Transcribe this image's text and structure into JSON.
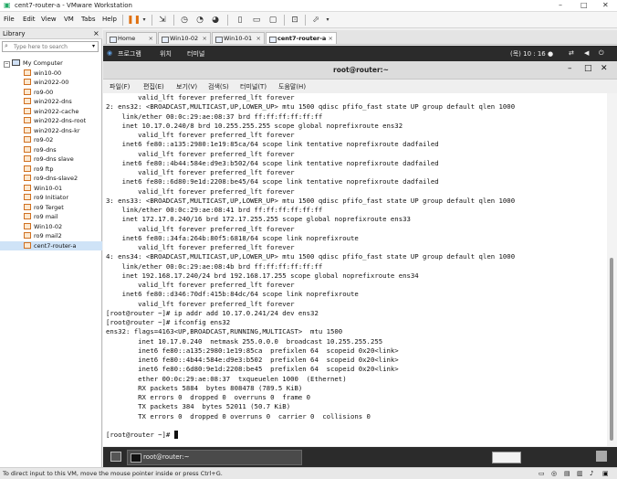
{
  "window": {
    "title": "cent7-router-a - VMware Workstation",
    "min_label": "–",
    "max_label": "□",
    "close_label": "✕"
  },
  "menu": {
    "file": "File",
    "edit": "Edit",
    "view": "View",
    "vm": "VM",
    "tabs": "Tabs",
    "help": "Help"
  },
  "library": {
    "title": "Library",
    "close": "×",
    "search_placeholder": "Type here to search",
    "root": "My Computer",
    "items": [
      "win10-00",
      "win2022-00",
      "ro9-00",
      "win2022-dns",
      "win2022-cache",
      "win2022-dns-root",
      "win2022-dns-kr",
      "ro9-02",
      "ro9-dns",
      "ro9-dns slave",
      "ro9 ftp",
      "ro9-dns-slave2",
      "Win10-01",
      "ro9 Initiator",
      "ro9 Terget",
      "ro9 mail",
      "Win10-02",
      "ro9 mail2",
      "cent7-router-a"
    ]
  },
  "tabs": [
    {
      "label": "Home"
    },
    {
      "label": "Win10-02"
    },
    {
      "label": "Win10-01"
    },
    {
      "label": "cent7-router-a"
    }
  ],
  "gnome": {
    "apps": "프로그램",
    "places": "위치",
    "terminal": "터미널",
    "clock": "(목) 10 : 16 ●"
  },
  "terminal": {
    "title": "root@router:~",
    "menu": [
      "파일(F)",
      "편집(E)",
      "보기(V)",
      "검색(S)",
      "터미널(T)",
      "도움말(H)"
    ],
    "lines": [
      "        valid_lft forever preferred_lft forever",
      "2: ens32: <BROADCAST,MULTICAST,UP,LOWER_UP> mtu 1500 qdisc pfifo_fast state UP group default qlen 1000",
      "    link/ether 00:0c:29:ae:08:37 brd ff:ff:ff:ff:ff:ff",
      "    inet 10.17.0.240/8 brd 10.255.255.255 scope global noprefixroute ens32",
      "        valid_lft forever preferred_lft forever",
      "    inet6 fe80::a135:2980:1e19:85ca/64 scope link tentative noprefixroute dadfailed",
      "        valid_lft forever preferred_lft forever",
      "    inet6 fe80::4b44:584e:d9e3:b502/64 scope link tentative noprefixroute dadfailed",
      "        valid_lft forever preferred_lft forever",
      "    inet6 fe80::6d80:9e1d:2208:be45/64 scope link tentative noprefixroute dadfailed",
      "        valid_lft forever preferred_lft forever",
      "3: ens33: <BROADCAST,MULTICAST,UP,LOWER_UP> mtu 1500 qdisc pfifo_fast state UP group default qlen 1000",
      "    link/ether 00:0c:29:ae:08:41 brd ff:ff:ff:ff:ff:ff",
      "    inet 172.17.0.240/16 brd 172.17.255.255 scope global noprefixroute ens33",
      "        valid_lft forever preferred_lft forever",
      "    inet6 fe80::34fa:264b:80f5:6818/64 scope link noprefixroute",
      "        valid_lft forever preferred_lft forever",
      "4: ens34: <BROADCAST,MULTICAST,UP,LOWER_UP> mtu 1500 qdisc pfifo_fast state UP group default qlen 1000",
      "    link/ether 00:0c:29:ae:08:4b brd ff:ff:ff:ff:ff:ff",
      "    inet 192.168.17.240/24 brd 192.168.17.255 scope global noprefixroute ens34",
      "        valid_lft forever preferred_lft forever",
      "    inet6 fe80::d346:70df:415b:84dc/64 scope link noprefixroute",
      "        valid_lft forever preferred_lft forever",
      "[root@router ~]# ip addr add 10.17.0.241/24 dev ens32",
      "[root@router ~]# ifconfig ens32",
      "ens32: flags=4163<UP,BROADCAST,RUNNING,MULTICAST>  mtu 1500",
      "        inet 10.17.0.240  netmask 255.0.0.0  broadcast 10.255.255.255",
      "        inet6 fe80::a135:2980:1e19:85ca  prefixlen 64  scopeid 0x20<link>",
      "        inet6 fe80::4b44:584e:d9e3:b502  prefixlen 64  scopeid 0x20<link>",
      "        inet6 fe80::6d80:9e1d:2208:be45  prefixlen 64  scopeid 0x20<link>",
      "        ether 00:0c:29:ae:08:37  txqueuelen 1000  (Ethernet)",
      "        RX packets 5884  bytes 808478 (789.5 KiB)",
      "        RX errors 0  dropped 0  overruns 0  frame 0",
      "        TX packets 384  bytes 52011 (50.7 KiB)",
      "        TX errors 0  dropped 0 overruns 0  carrier 0  collisions 0",
      "",
      "[root@router ~]# "
    ]
  },
  "taskbar": {
    "item": "root@router:~"
  },
  "status": {
    "text": "To direct input to this VM, move the mouse pointer inside or press Ctrl+G."
  }
}
